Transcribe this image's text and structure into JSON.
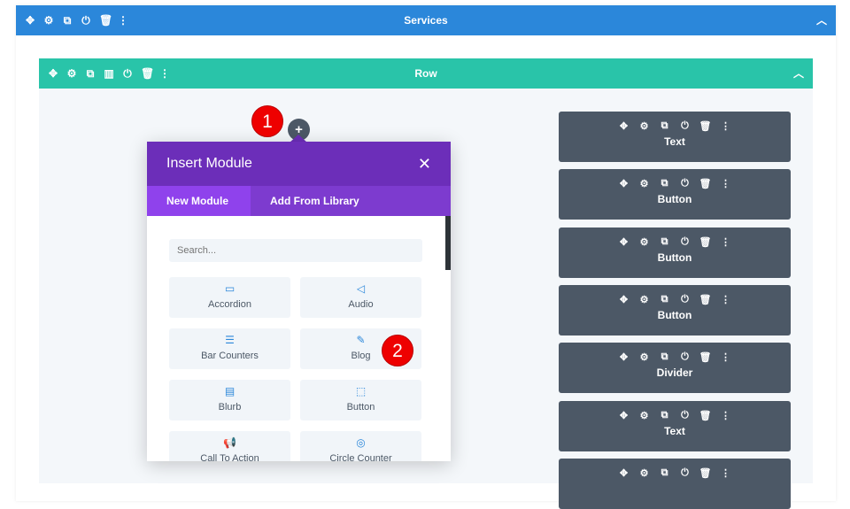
{
  "section": {
    "title": "Services",
    "icons": [
      "move-icon",
      "gear-icon",
      "duplicate-icon",
      "power-icon",
      "trash-icon",
      "more-icon"
    ]
  },
  "row": {
    "title": "Row"
  },
  "modules": [
    {
      "label": "Text"
    },
    {
      "label": "Button"
    },
    {
      "label": "Button"
    },
    {
      "label": "Button"
    },
    {
      "label": "Divider"
    },
    {
      "label": "Text"
    },
    {
      "label": ""
    }
  ],
  "popup": {
    "title": "Insert Module",
    "close": "✕",
    "tabs": [
      "New Module",
      "Add From Library"
    ],
    "search_placeholder": "Search...",
    "items": [
      {
        "label": "Accordion",
        "icon": "▭"
      },
      {
        "label": "Audio",
        "icon": "◁"
      },
      {
        "label": "Bar Counters",
        "icon": "☰"
      },
      {
        "label": "Blog",
        "icon": "✎"
      },
      {
        "label": "Blurb",
        "icon": "▤"
      },
      {
        "label": "Button",
        "icon": "⬚"
      },
      {
        "label": "Call To Action",
        "icon": "📢"
      },
      {
        "label": "Circle Counter",
        "icon": "◎"
      }
    ]
  },
  "badges": [
    "1",
    "2"
  ],
  "colors": {
    "section": "#2b87da",
    "row": "#29c4a9",
    "module": "#4c5866",
    "popup": "#6c2eb9"
  }
}
